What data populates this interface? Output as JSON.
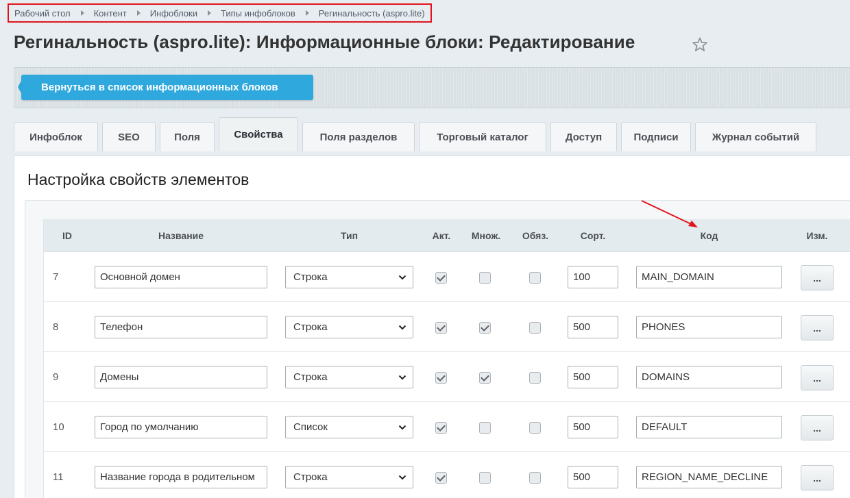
{
  "breadcrumb": [
    "Рабочий стол",
    "Контент",
    "Инфоблоки",
    "Типы инфоблоков",
    "Регинальность (aspro.lite)"
  ],
  "page": {
    "title": "Регинальность (aspro.lite): Информационные блоки: Редактирование"
  },
  "toolbar": {
    "back_label": "Вернуться в список информационных блоков"
  },
  "tabs": [
    "Инфоблок",
    "SEO",
    "Поля",
    "Свойства",
    "Поля разделов",
    "Торговый каталог",
    "Доступ",
    "Подписи",
    "Журнал событий"
  ],
  "active_tab": "Свойства",
  "section_title": "Настройка свойств элементов",
  "table": {
    "headers": {
      "id": "ID",
      "name": "Название",
      "type": "Тип",
      "active": "Акт.",
      "multiple": "Множ.",
      "required": "Обяз.",
      "sort": "Сорт.",
      "code": "Код",
      "edit": "Изм."
    },
    "rows": [
      {
        "id": "7",
        "name": "Основной домен",
        "type": "Строка",
        "active": true,
        "multiple": false,
        "required": false,
        "sort": "100",
        "code": "MAIN_DOMAIN",
        "edit": "..."
      },
      {
        "id": "8",
        "name": "Телефон",
        "type": "Строка",
        "active": true,
        "multiple": true,
        "required": false,
        "sort": "500",
        "code": "PHONES",
        "edit": "..."
      },
      {
        "id": "9",
        "name": "Домены",
        "type": "Строка",
        "active": true,
        "multiple": true,
        "required": false,
        "sort": "500",
        "code": "DOMAINS",
        "edit": "..."
      },
      {
        "id": "10",
        "name": "Город по умолчанию",
        "type": "Список",
        "active": true,
        "multiple": false,
        "required": false,
        "sort": "500",
        "code": "DEFAULT",
        "edit": "..."
      },
      {
        "id": "11",
        "name": "Название города в родительном",
        "type": "Строка",
        "active": true,
        "multiple": false,
        "required": false,
        "sort": "500",
        "code": "REGION_NAME_DECLINE",
        "edit": "..."
      }
    ]
  },
  "colors": {
    "accent": "#2fa8dd",
    "highlight_border": "#e0141c",
    "annotation_arrow": "#e0141c"
  },
  "icons": {
    "star": "star-icon",
    "dropdown": "chevron-down-icon",
    "breadcrumb_separator": "triangle-right-icon"
  }
}
